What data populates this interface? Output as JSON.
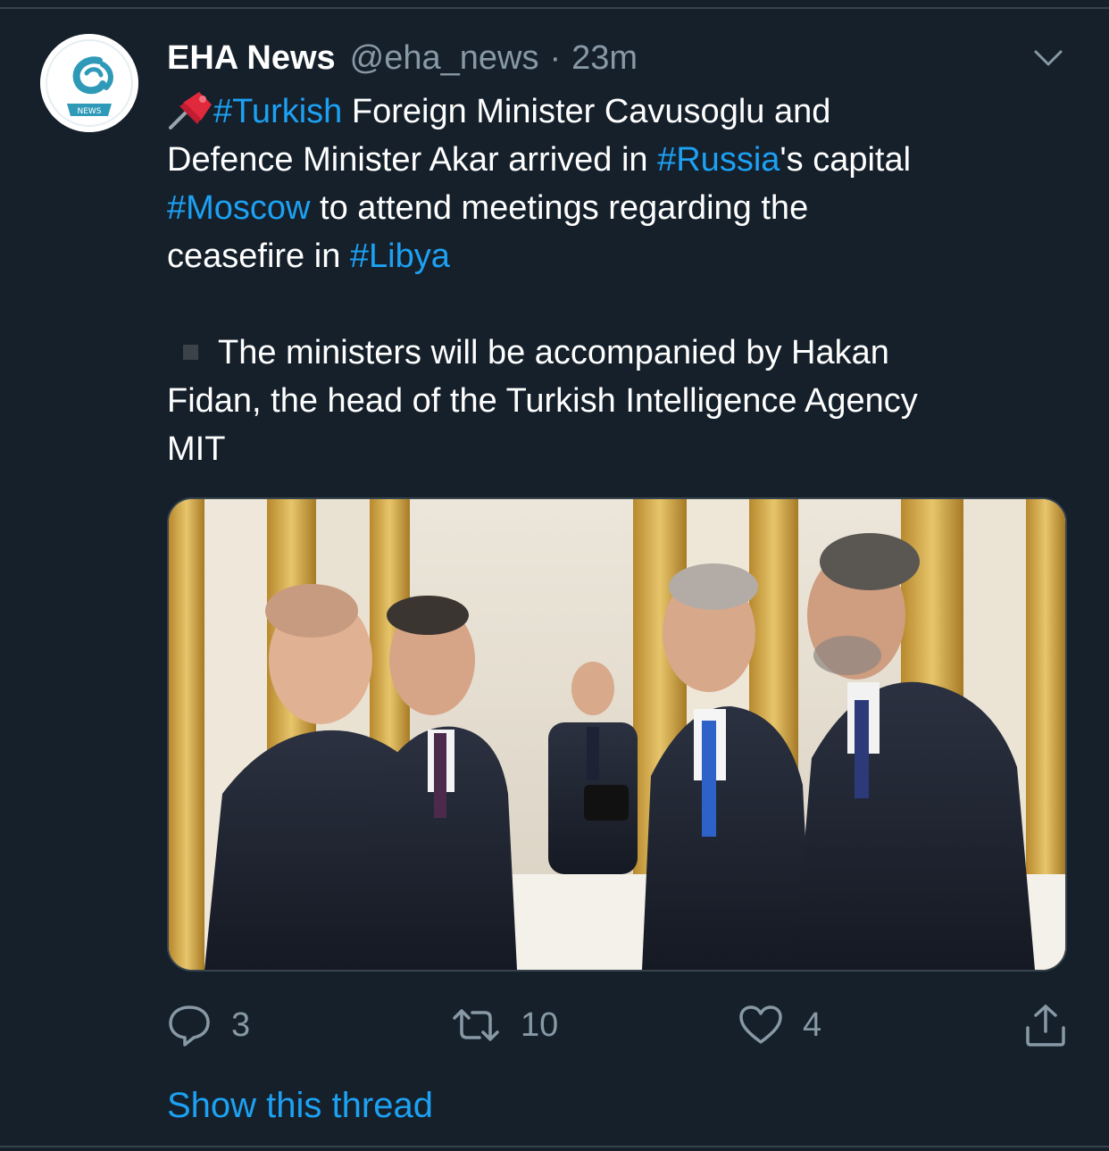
{
  "tweet": {
    "author_name": "EHA News",
    "author_handle": "@eha_news",
    "separator": "·",
    "timestamp": "23m",
    "avatar_label": "NEWS",
    "text": {
      "p1_l1_tag": "#Turkish",
      "p1_l1_rest": " Foreign Minister Cavusoglu and",
      "p1_l2_a": "Defence Minister Akar arrived in ",
      "p1_l2_tag": "#Russia",
      "p1_l2_b": "'s capital",
      "p1_l3_tag": "#Moscow",
      "p1_l3_rest": " to attend meetings regarding the",
      "p1_l4_a": "ceasefire in ",
      "p1_l4_tag": "#Libya",
      "p2_l1": "The ministers will be accompanied by Hakan",
      "p2_l2": "Fidan, the head of the Turkish Intelligence Agency",
      "p2_l3": "MIT"
    },
    "actions": {
      "reply_count": "3",
      "retweet_count": "10",
      "like_count": "4"
    },
    "show_thread": "Show this thread"
  },
  "icons": {
    "emoji": "pushpin-icon",
    "bullet": "black-square-icon",
    "menu": "chevron-down-icon",
    "reply": "reply-icon",
    "retweet": "retweet-icon",
    "like": "heart-icon",
    "share": "share-icon"
  },
  "colors": {
    "background": "#15202b",
    "text": "#ffffff",
    "secondary_text": "#8899a6",
    "link": "#1da1f2",
    "divider": "#38444d",
    "avatar_accent": "#2f9ab8"
  }
}
